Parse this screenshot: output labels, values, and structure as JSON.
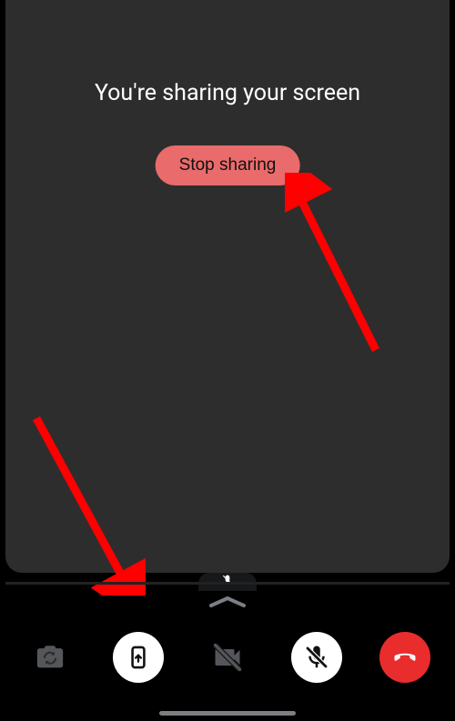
{
  "colors": {
    "panel_bg": "#2d2d2d",
    "stop_bg": "#ea6b6b",
    "end_bg": "#e92c2c",
    "arrow": "#ff0000"
  },
  "share": {
    "title": "You're sharing your screen",
    "stop_label": "Stop sharing"
  },
  "toolbar": {
    "switch_camera": "switch-camera",
    "share_screen": "share-screen",
    "video_off": "video-off",
    "mic_off": "mic-off",
    "end_call": "end-call"
  }
}
